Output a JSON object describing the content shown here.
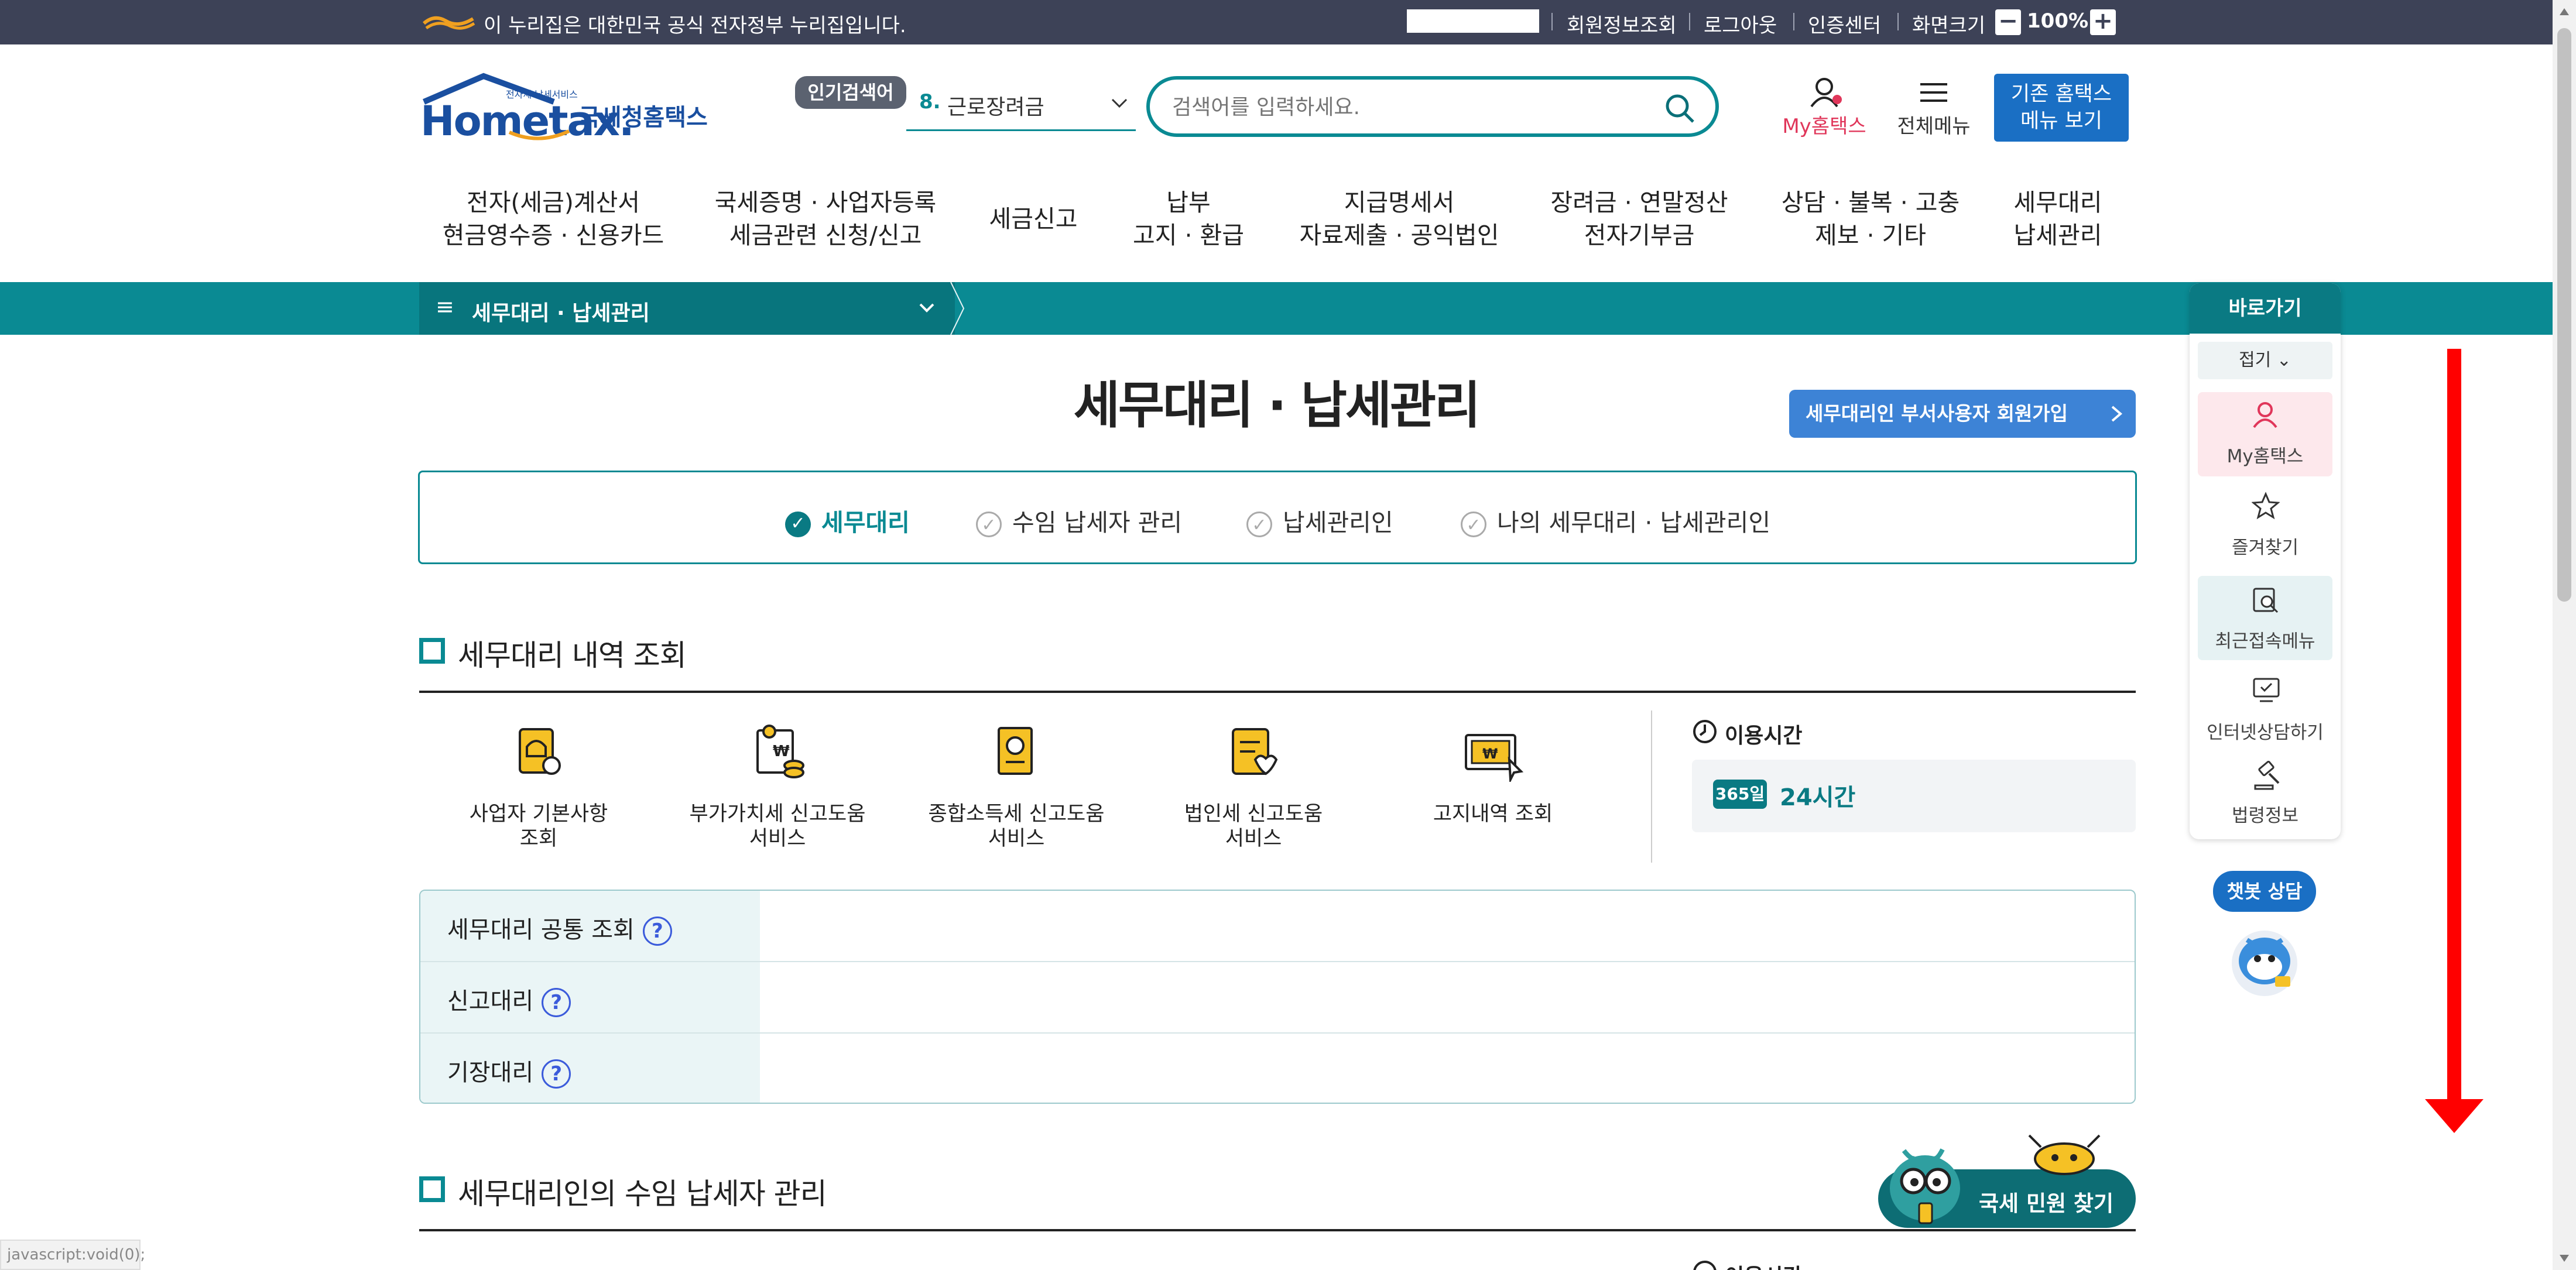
{
  "gov_bar": {
    "notice": "이 누리집은 대한민국 공식 전자정부 누리집입니다.",
    "links": [
      "회원정보조회",
      "로그아웃",
      "인증센터",
      "화면크기"
    ],
    "zoom": "100%",
    "zoom_minus": "−",
    "zoom_plus": "+"
  },
  "header": {
    "logo_small": "전자세 납세서비스",
    "logo_main": "Hometax.",
    "logo_sub": "국세청홈택스",
    "popular_label": "인기검색어",
    "popular_rank": "8.",
    "popular_term": "근로장려금",
    "search_placeholder": "검색어를 입력하세요.",
    "my_hometax": "My홈택스",
    "all_menu": "전체메뉴",
    "legacy_button": [
      "기존 홈택스",
      "메뉴 보기"
    ]
  },
  "gnb": [
    [
      "전자(세금)계산서",
      "현금영수증 · 신용카드"
    ],
    [
      "국세증명 · 사업자등록",
      "세금관련 신청/신고"
    ],
    [
      "세금신고"
    ],
    [
      "납부",
      "고지 · 환급"
    ],
    [
      "지급명세서",
      "자료제출 · 공익법인"
    ],
    [
      "장려금 · 연말정산",
      "전자기부금"
    ],
    [
      "상담 · 불복 · 고충",
      "제보 · 기타"
    ],
    [
      "세무대리",
      "납세관리"
    ]
  ],
  "location_bar": {
    "current": "세무대리 · 납세관리"
  },
  "page": {
    "title": "세무대리 · 납세관리",
    "join_button": "세무대리인 부서사용자 회원가입",
    "tabs": [
      "세무대리",
      "수임 납세자 관리",
      "납세관리인",
      "나의 세무대리 · 납세관리인"
    ],
    "active_tab": "세무대리"
  },
  "section1": {
    "title": "세무대리 내역 조회",
    "services": [
      {
        "label": [
          "사업자 기본사항",
          "조회"
        ],
        "icon": "business-info-icon"
      },
      {
        "label": [
          "부가가치세 신고도움",
          "서비스"
        ],
        "icon": "vat-help-icon"
      },
      {
        "label": [
          "종합소득세 신고도움",
          "서비스"
        ],
        "icon": "income-tax-help-icon"
      },
      {
        "label": [
          "법인세 신고도움",
          "서비스"
        ],
        "icon": "corporate-tax-help-icon"
      },
      {
        "label": [
          "고지내역 조회"
        ],
        "icon": "notice-history-icon"
      }
    ],
    "hours_label": "이용시간",
    "hours_badge": "365일",
    "hours_value": "24시간",
    "rows": [
      "세무대리 공통 조회",
      "신고대리",
      "기장대리"
    ],
    "help_mark": "?"
  },
  "section2": {
    "title": "세무대리인의 수임 납세자 관리",
    "hours_label_partial": "이용시간"
  },
  "quick_panel": {
    "title": "바로가기",
    "fold": "접기",
    "items": [
      "My홈택스",
      "즐겨찾기",
      "최근접속메뉴",
      "인터넷상담하기",
      "법령정보"
    ]
  },
  "chatbot": {
    "label": "챗봇 상담"
  },
  "civil_button": "국세 민원 찾기",
  "status_bar": "javascript:void(0);",
  "colors": {
    "gov_bar": "#3d4257",
    "teal": "#0a8a93",
    "accent_blue": "#1a6fc4",
    "arrow_red": "#ff0000"
  }
}
